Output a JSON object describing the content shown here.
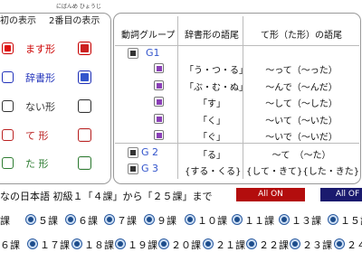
{
  "left_panel": {
    "header": [
      "初の表示",
      "2番目の表示"
    ],
    "header_ruby": [
      "",
      "にばんめ  ひょうじ"
    ],
    "rows": [
      {
        "label": "ます形",
        "color": "#cc0000",
        "first_fill": "#e01010",
        "second_fill": "#cc2222"
      },
      {
        "label": "辞書形",
        "color": "#2233bb",
        "first_fill": "#ffffff",
        "second_fill": "#3355cc"
      },
      {
        "label": "ない形",
        "color": "#333333",
        "first_fill": "#ffffff",
        "second_fill": "#ffffff"
      },
      {
        "label": "て 形",
        "color": "#bb2222",
        "first_fill": "#ffffff",
        "second_fill": "#ffffff"
      },
      {
        "label": "た 形",
        "color": "#2e7d32",
        "first_fill": "#ffffff",
        "second_fill": "#ffffff"
      }
    ]
  },
  "right_panel": {
    "headers": [
      "動詞グループ",
      "辞書形の語尾",
      "て形（た形）の語尾"
    ],
    "groups": {
      "g1": "G1",
      "g2": "G 2",
      "g3": "G 3"
    },
    "rows": [
      {
        "dict": "「う・つ・る」",
        "te": "〜って（〜った）"
      },
      {
        "dict": "「ぶ・む・ぬ」",
        "te": "〜んで（〜んだ）"
      },
      {
        "dict": "「す」",
        "te": "〜して（〜した）"
      },
      {
        "dict": "「く」",
        "te": "〜いて（〜いた）"
      },
      {
        "dict": "「ぐ」",
        "te": "〜いで（〜いだ）"
      },
      {
        "dict": "「る」",
        "te": "〜て　（〜た）"
      },
      {
        "dict": "{する・くる}",
        "te": "{して・きて}{した・きた}"
      }
    ]
  },
  "bottom": {
    "caption": "なの日本語 初級１「４課」から「２５課」まで",
    "all_on": "All ON",
    "all_off": "All OF",
    "row1": [
      "課",
      "５課",
      "６課",
      "７課",
      "９課",
      "１０課",
      "１１課",
      "１３課",
      "１５課"
    ],
    "row2": [
      "６課",
      "１７課",
      "１８課",
      "１９課",
      "２０課",
      "２１課",
      "２２課",
      "２３課",
      "２４課"
    ]
  },
  "colors": {
    "all_on_bg": "#b30d0d",
    "all_off_bg": "#1a1a6e",
    "panel_border": "#999999"
  }
}
